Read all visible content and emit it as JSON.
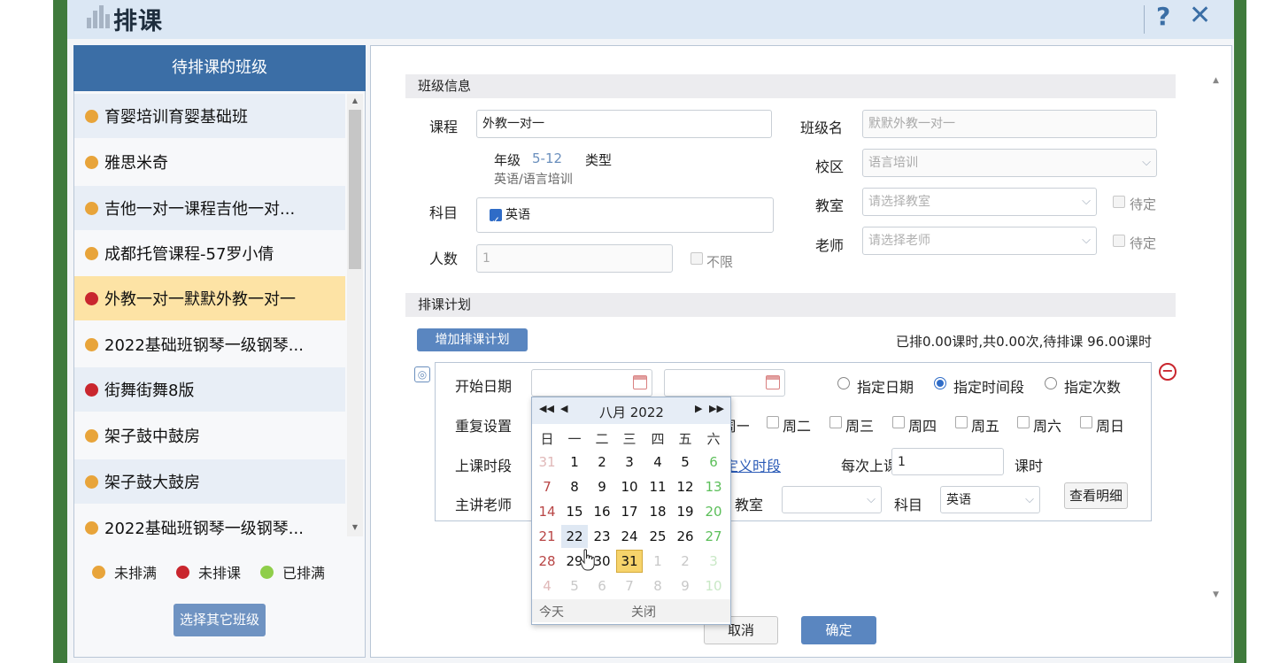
{
  "dialog": {
    "title": "排课",
    "help": "?",
    "close": "✕"
  },
  "left_panel": {
    "header": "待排课的班级",
    "classes": [
      {
        "name": "育婴培训育婴基础班",
        "status": "orange"
      },
      {
        "name": "雅思米奇",
        "status": "orange"
      },
      {
        "name": "吉他一对一课程吉他一对...",
        "status": "orange"
      },
      {
        "name": "成都托管课程-57罗小倩",
        "status": "orange"
      },
      {
        "name": "外教一对一默默外教一对一",
        "status": "red"
      },
      {
        "name": "2022基础班钢琴一级钢琴...",
        "status": "orange"
      },
      {
        "name": "街舞街舞8版",
        "status": "red"
      },
      {
        "name": "架子鼓中鼓房",
        "status": "orange"
      },
      {
        "name": "架子鼓大鼓房",
        "status": "orange"
      },
      {
        "name": "2022基础班钢琴一级钢琴...",
        "status": "orange"
      }
    ],
    "legend": {
      "not_full": "未排满",
      "not_scheduled": "未排课",
      "full": "已排满"
    },
    "choose_other_button": "选择其它班级"
  },
  "class_info": {
    "section_title": "班级信息",
    "course_label": "课程",
    "course_value": "外教一对一",
    "grade_label": "年级",
    "grade_value": "5-12",
    "type_label": "类型",
    "type_value": "英语/语言培训",
    "subject_label": "科目",
    "subject_value": "英语",
    "count_label": "人数",
    "count_value": "1",
    "unlimited_label": "不限",
    "class_name_label": "班级名",
    "class_name_value": "默默外教一对一",
    "campus_label": "校区",
    "campus_value": "语言培训",
    "classroom_label": "教室",
    "classroom_placeholder": "请选择教室",
    "teacher_label": "老师",
    "teacher_placeholder": "请选择老师",
    "pending_label": "待定"
  },
  "schedule_plan": {
    "section_title": "排课计划",
    "add_plan_button": "增加排课计划",
    "summary": "已排0.00课时,共0.00次,待排课 96.00课时",
    "start_date_label": "开始日期",
    "mode_options": [
      "指定日期",
      "指定时间段",
      "指定次数"
    ],
    "mode_selected": "指定时间段",
    "repeat_label": "重复设置",
    "weekdays": [
      "周一",
      "周二",
      "周三",
      "周四",
      "周五",
      "周六",
      "周日"
    ],
    "weekday_partial": "周一",
    "time_label": "上课时段",
    "custom_time_link": "自定义时段",
    "custom_time_visible": "定义时段",
    "each_label": "每次上课",
    "each_value": "1",
    "hours_unit": "课时",
    "lecturer_label": "主讲老师",
    "classroom_label": "教室",
    "subject_label": "科目",
    "subject_value": "英语",
    "detail_button": "查看明细"
  },
  "footer": {
    "cancel_button": "取消",
    "ok_button": "确定"
  },
  "calendar": {
    "month_title": "八月 2022",
    "weekday_headers": [
      "日",
      "一",
      "二",
      "三",
      "四",
      "五",
      "六"
    ],
    "weeks": [
      [
        "31",
        "1",
        "2",
        "3",
        "4",
        "5",
        "6"
      ],
      [
        "7",
        "8",
        "9",
        "10",
        "11",
        "12",
        "13"
      ],
      [
        "14",
        "15",
        "16",
        "17",
        "18",
        "19",
        "20"
      ],
      [
        "21",
        "22",
        "23",
        "24",
        "25",
        "26",
        "27"
      ],
      [
        "28",
        "29",
        "30",
        "31",
        "1",
        "2",
        "3"
      ],
      [
        "4",
        "5",
        "6",
        "7",
        "8",
        "9",
        "10"
      ]
    ],
    "selected_day": "31",
    "hover_day": "22",
    "today_label": "今天",
    "close_label": "关闭"
  }
}
